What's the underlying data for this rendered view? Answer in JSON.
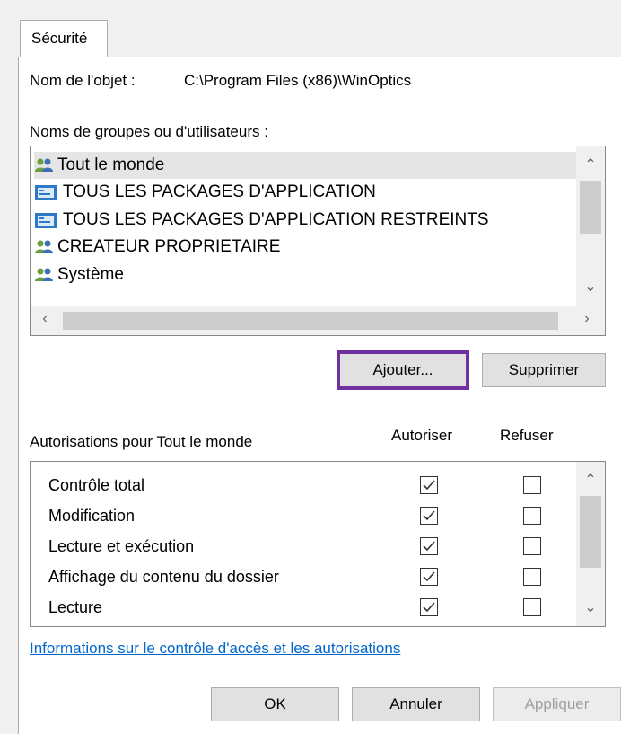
{
  "tab": {
    "label": "Sécurité"
  },
  "object": {
    "label": "Nom de l'objet :",
    "value": "C:\\Program Files (x86)\\WinOptics"
  },
  "groups": {
    "label": "Noms de groupes ou d'utilisateurs :",
    "items": [
      {
        "label": "Tout le monde",
        "icon": "users-icon",
        "selected": true
      },
      {
        "label": "TOUS LES PACKAGES D'APPLICATION",
        "icon": "app-package-icon"
      },
      {
        "label": "TOUS LES PACKAGES D'APPLICATION RESTREINTS",
        "icon": "app-package-icon"
      },
      {
        "label": "CREATEUR PROPRIETAIRE",
        "icon": "users-icon"
      },
      {
        "label": "Système",
        "icon": "users-icon"
      }
    ]
  },
  "buttons": {
    "add": "Ajouter...",
    "remove": "Supprimer",
    "ok": "OK",
    "cancel": "Annuler",
    "apply": "Appliquer"
  },
  "permissions": {
    "title": "Autorisations pour Tout le monde",
    "allow_header": "Autoriser",
    "deny_header": "Refuser",
    "rows": [
      {
        "label": "Contrôle total",
        "allow": true,
        "deny": false
      },
      {
        "label": "Modification",
        "allow": true,
        "deny": false
      },
      {
        "label": "Lecture et exécution",
        "allow": true,
        "deny": false
      },
      {
        "label": "Affichage du contenu du dossier",
        "allow": true,
        "deny": false
      },
      {
        "label": "Lecture",
        "allow": true,
        "deny": false
      }
    ]
  },
  "link": "Informations sur le contrôle d'accès et les autorisations",
  "colors": {
    "highlight": "#7030a0",
    "link": "#0066cc",
    "selected_row": "#e5e5e5"
  }
}
